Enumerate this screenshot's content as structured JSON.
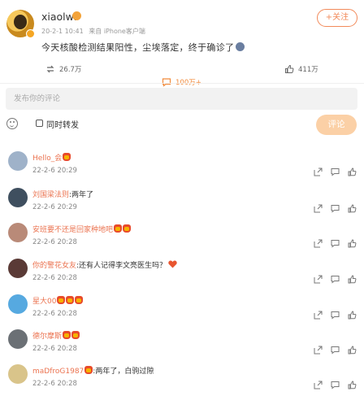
{
  "post": {
    "username": "xiaolwl",
    "time": "20-2-1 10:41",
    "source": "来自 iPhone客户端",
    "text": "今天核酸检测结果阳性，尘埃落定，终于确诊了",
    "follow_label": "+关注"
  },
  "actions": {
    "repost_count": "26.7万",
    "comment_count": "100万+",
    "like_count": "411万"
  },
  "composer": {
    "placeholder": "发布你的评论",
    "repost_option_label": "同时转发",
    "submit_label": "评论"
  },
  "comments": [
    {
      "name": "Hello_会",
      "text": "",
      "time": "22-2-6 20:29",
      "avatar_color": "#9fb2c9"
    },
    {
      "name": "刘国梁法则",
      "text": ":两年了",
      "time": "22-2-6 20:29",
      "avatar_color": "#3f4f5f"
    },
    {
      "name": "安班要不还是回家种地吧",
      "text": "",
      "time": "22-2-6 20:28",
      "avatar_color": "#b98a78"
    },
    {
      "name": "你的警花女友",
      "text": ":还有人记得李文亮医生吗？",
      "time": "22-2-6 20:28",
      "avatar_color": "#5a3a36"
    },
    {
      "name": "星大00",
      "text": "",
      "time": "22-2-6 20:28",
      "avatar_color": "#56a9e0"
    },
    {
      "name": "德尔摩斯",
      "text": "",
      "time": "22-2-6 20:28",
      "avatar_color": "#6b7075"
    },
    {
      "name": "maDfroG1987",
      "text": ":两年了，白驹过隙",
      "time": "22-2-6 20:28",
      "avatar_color": "#d9c48a"
    }
  ],
  "colors": {
    "accent": "#f28a5a",
    "name_link": "#eb7350",
    "submit_bg": "#fbd0a6"
  }
}
